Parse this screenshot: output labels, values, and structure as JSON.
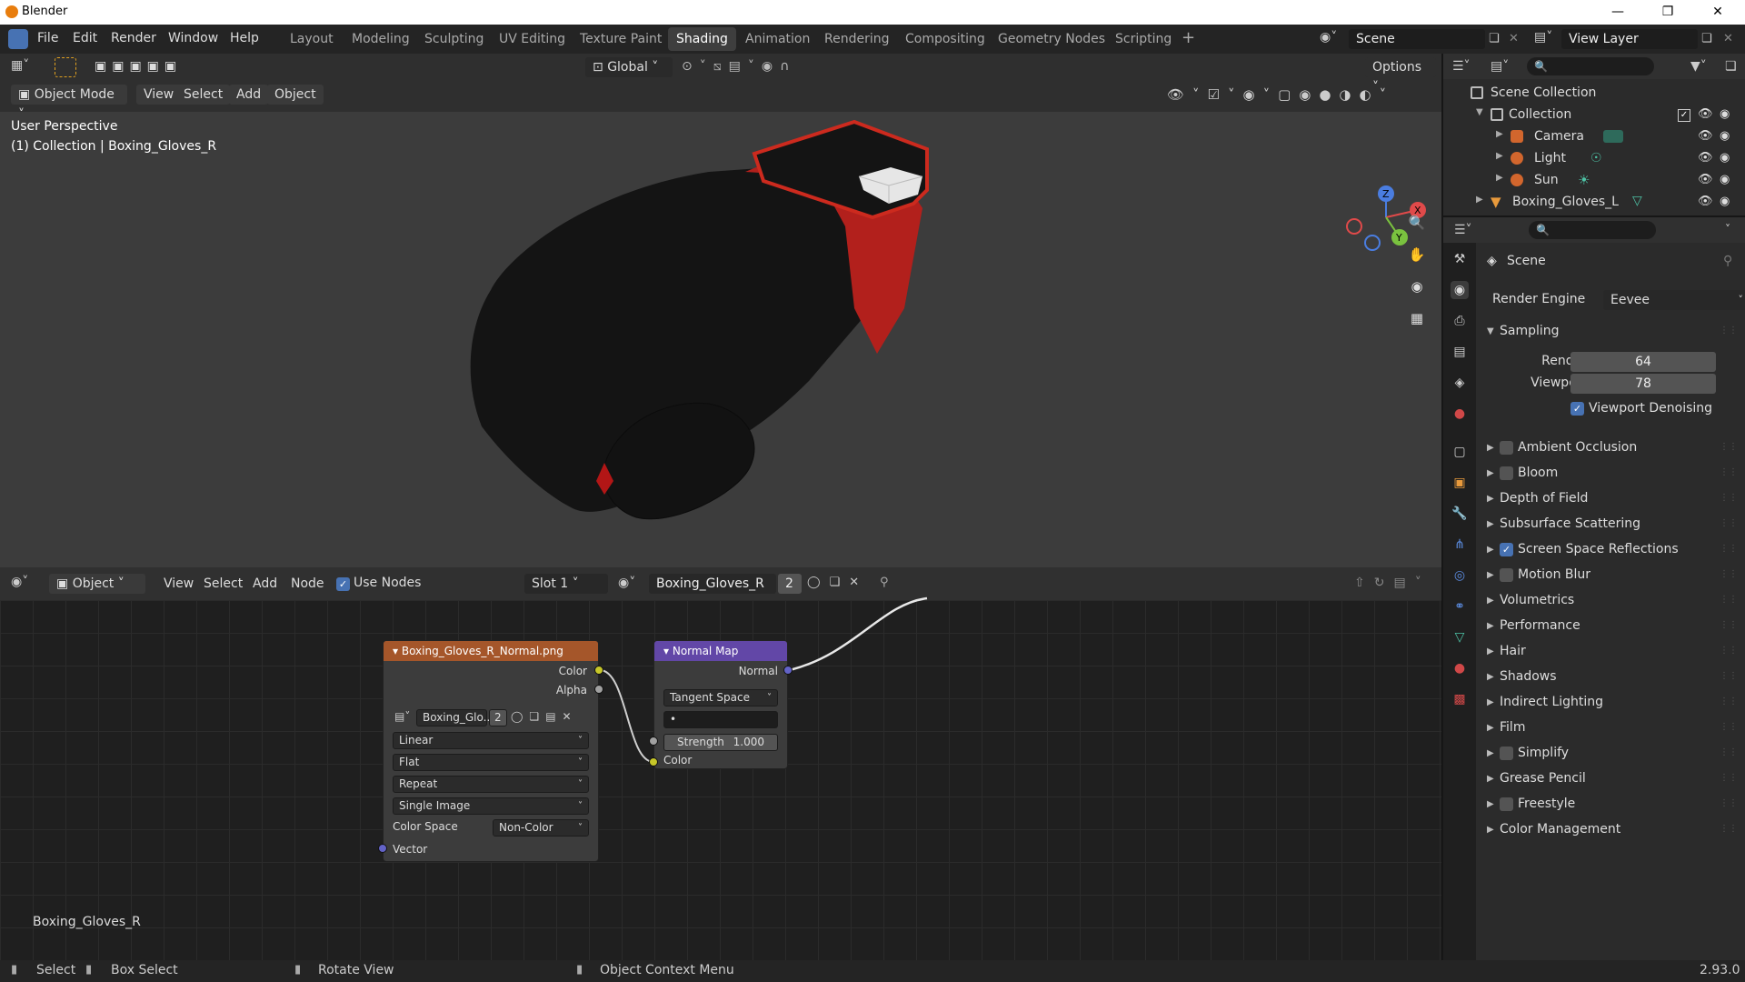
{
  "app": {
    "title": "Blender",
    "version": "2.93.0"
  },
  "topmenu": [
    "File",
    "Edit",
    "Render",
    "Window",
    "Help"
  ],
  "workspaces": [
    "Layout",
    "Modeling",
    "Sculpting",
    "UV Editing",
    "Texture Paint",
    "Shading",
    "Animation",
    "Rendering",
    "Compositing",
    "Geometry Nodes",
    "Scripting"
  ],
  "active_workspace": "Shading",
  "scene_name": "Scene",
  "view_layer": "View Layer",
  "viewport": {
    "mode": "Object Mode",
    "menus": [
      "View",
      "Select",
      "Add",
      "Object"
    ],
    "orientation": "Global",
    "options": "Options",
    "overlay_line1": "User Perspective",
    "overlay_line2": "(1) Collection | Boxing_Gloves_R",
    "gizmo": {
      "z": "Z",
      "x": "X",
      "y": "Y"
    }
  },
  "node_editor": {
    "object_type": "Object",
    "menus": [
      "View",
      "Select",
      "Add",
      "Node"
    ],
    "use_nodes": "Use Nodes",
    "slot": "Slot 1",
    "material": "Boxing_Gloves_R",
    "users": "2",
    "footer_label": "Boxing_Gloves_R",
    "image_node": {
      "title": "Boxing_Gloves_R_Normal.png",
      "out_color": "Color",
      "out_alpha": "Alpha",
      "image_name": "Boxing_Glo...",
      "users": "2",
      "interpolation": "Linear",
      "projection": "Flat",
      "extension": "Repeat",
      "source": "Single Image",
      "colorspace_label": "Color Space",
      "colorspace": "Non-Color",
      "in_vector": "Vector"
    },
    "normal_node": {
      "title": "Normal Map",
      "out_normal": "Normal",
      "space": "Tangent Space",
      "uv": "•",
      "strength_label": "Strength",
      "strength": "1.000",
      "in_color": "Color"
    }
  },
  "outliner": {
    "root": "Scene Collection",
    "items": [
      {
        "name": "Collection",
        "level": 0
      },
      {
        "name": "Camera",
        "level": 1
      },
      {
        "name": "Light",
        "level": 1
      },
      {
        "name": "Sun",
        "level": 1
      },
      {
        "name": "Boxing_Gloves_L",
        "level": 0
      }
    ]
  },
  "properties": {
    "context": "Scene",
    "render_engine_label": "Render Engine",
    "render_engine": "Eevee",
    "sampling": "Sampling",
    "render_label": "Render",
    "render_samples": "64",
    "viewport_label": "Viewport",
    "viewport_samples": "78",
    "denoise": "Viewport Denoising",
    "panels": [
      {
        "label": "Ambient Occlusion",
        "cb": true,
        "on": false
      },
      {
        "label": "Bloom",
        "cb": true,
        "on": false
      },
      {
        "label": "Depth of Field",
        "cb": false
      },
      {
        "label": "Subsurface Scattering",
        "cb": false
      },
      {
        "label": "Screen Space Reflections",
        "cb": true,
        "on": true
      },
      {
        "label": "Motion Blur",
        "cb": true,
        "on": false
      },
      {
        "label": "Volumetrics",
        "cb": false
      },
      {
        "label": "Performance",
        "cb": false
      },
      {
        "label": "Hair",
        "cb": false
      },
      {
        "label": "Shadows",
        "cb": false
      },
      {
        "label": "Indirect Lighting",
        "cb": false
      },
      {
        "label": "Film",
        "cb": false
      },
      {
        "label": "Simplify",
        "cb": true,
        "on": false
      },
      {
        "label": "Grease Pencil",
        "cb": false
      },
      {
        "label": "Freestyle",
        "cb": true,
        "on": false
      },
      {
        "label": "Color Management",
        "cb": false
      }
    ]
  },
  "statusbar": {
    "select": "Select",
    "box_select": "Box Select",
    "rotate": "Rotate View",
    "context_menu": "Object Context Menu"
  }
}
